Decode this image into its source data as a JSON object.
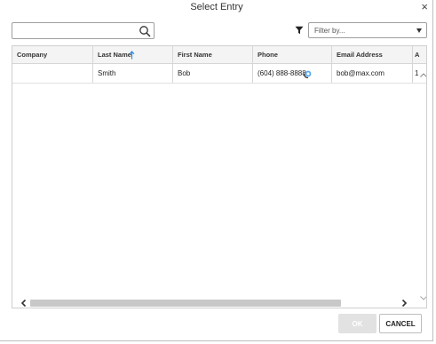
{
  "dialog": {
    "title": "Select Entry",
    "close_label": "×"
  },
  "search": {
    "value": "",
    "placeholder": ""
  },
  "filter": {
    "placeholder": "Filter by..."
  },
  "grid": {
    "columns": [
      {
        "label": "Company"
      },
      {
        "label": "Last Name"
      },
      {
        "label": "First Name"
      },
      {
        "label": "Phone"
      },
      {
        "label": "Email Address"
      },
      {
        "label": "A"
      }
    ],
    "sort_column": "Last Name",
    "sort_direction": "ascending",
    "rows": [
      {
        "company": "",
        "last_name": "Smith",
        "first_name": "Bob",
        "phone": "(604) 888-8888",
        "email": "bob@max.com",
        "extra": "1"
      }
    ]
  },
  "buttons": {
    "ok_label": "OK",
    "cancel_label": "CANCEL"
  },
  "colors": {
    "accent": "#1e88e5",
    "ok_disabled": "#e2e2e2"
  }
}
